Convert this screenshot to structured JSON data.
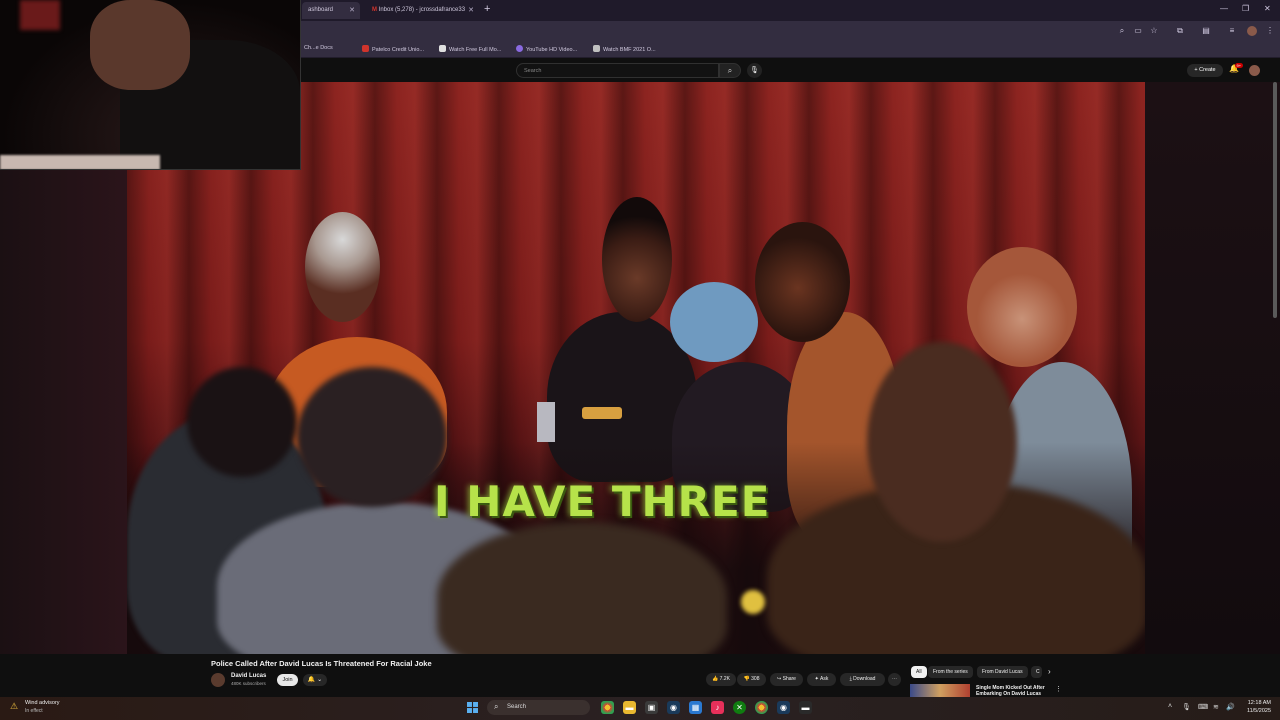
{
  "browser": {
    "tabs": [
      {
        "label": "ashboard",
        "active": true
      },
      {
        "label": "Inbox (5,278) - jcrossdafrance33",
        "active": false
      }
    ],
    "new_tab": "+",
    "window_controls": {
      "minimize": "—",
      "maximize": "❐",
      "close": "✕"
    },
    "bookmarks": [
      {
        "label": "Ch...e Docs",
        "color": "#4a8af0"
      },
      {
        "label": "Patelco Credit Unio...",
        "color": "#d0342c"
      },
      {
        "label": "Watch Free Full Mo...",
        "color": "#e0e0e0"
      },
      {
        "label": "YouTube HD Video...",
        "color": "#8a6ae0"
      },
      {
        "label": "Watch BMF 2021 O...",
        "color": "#c0c0c0"
      }
    ]
  },
  "youtube": {
    "search_placeholder": "Search",
    "create_label": "Create",
    "notif_badge": "9+",
    "video": {
      "caption": "I HAVE THREE",
      "title": "Police Called After David Lucas Is Threatened For Racial Joke",
      "channel": "David Lucas",
      "subscribers": "480K subscribers",
      "join_label": "Join",
      "likes": "7.2K",
      "dislikes": "308",
      "share_label": "Share",
      "ask_label": "Ask",
      "download_label": "Download"
    },
    "chips": [
      {
        "label": "All",
        "selected": true
      },
      {
        "label": "From the series",
        "selected": false
      },
      {
        "label": "From David Lucas",
        "selected": false
      },
      {
        "label": "C",
        "selected": false
      }
    ],
    "recommendation": {
      "title": "Single Mom Kicked Out After Embarking On David Lucas"
    }
  },
  "taskbar": {
    "weather_line1": "Wind advisory",
    "weather_line2": "In effect",
    "search_label": "Search",
    "time": "12:18 AM",
    "date": "11/5/2025"
  },
  "colors": {
    "caption": "#b6e24a",
    "accent_red": "#cc0000",
    "chrome_bg": "#332d40"
  }
}
